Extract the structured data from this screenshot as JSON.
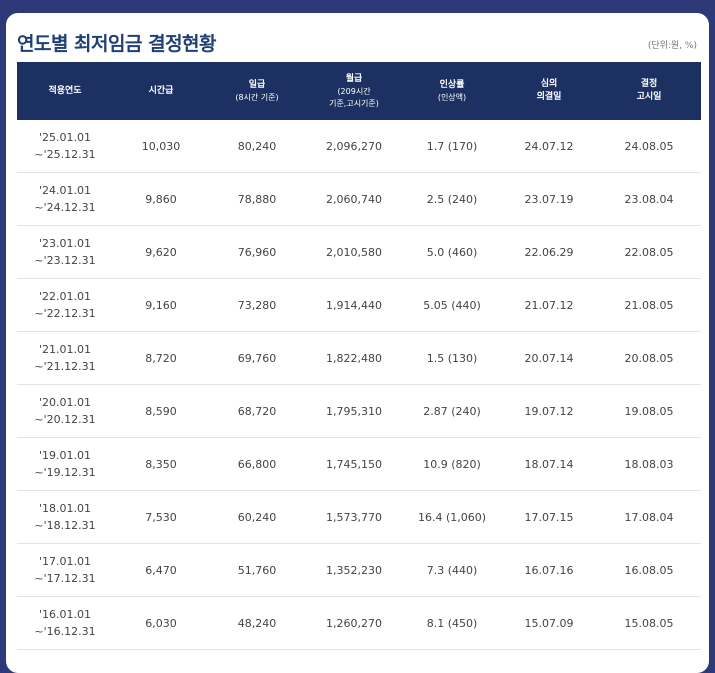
{
  "title": "연도별 최저임금 결정현황",
  "unit": "(단위:원, %)",
  "headers": [
    {
      "main": "적용연도"
    },
    {
      "main": "시간급"
    },
    {
      "main": "일급",
      "sub": "(8시간 기준)"
    },
    {
      "main": "월급",
      "sub1": "(209시간",
      "sub2": "기준,고시기준)"
    },
    {
      "main": "인상률",
      "sub": "(인상액)"
    },
    {
      "line1": "심의",
      "line2": "의결일"
    },
    {
      "line1": "결정",
      "line2": "고시일"
    }
  ],
  "rows": [
    {
      "year_start": "'25.01.01",
      "year_end": "~'25.12.31",
      "hourly": "10,030",
      "daily": "80,240",
      "monthly": "2,096,270",
      "rate": "1.7 (170)",
      "deliberation": "24.07.12",
      "notice": "24.08.05"
    },
    {
      "year_start": "'24.01.01",
      "year_end": "~'24.12.31",
      "hourly": "9,860",
      "daily": "78,880",
      "monthly": "2,060,740",
      "rate": "2.5 (240)",
      "deliberation": "23.07.19",
      "notice": "23.08.04"
    },
    {
      "year_start": "'23.01.01",
      "year_end": "~'23.12.31",
      "hourly": "9,620",
      "daily": "76,960",
      "monthly": "2,010,580",
      "rate": "5.0 (460)",
      "deliberation": "22.06.29",
      "notice": "22.08.05"
    },
    {
      "year_start": "'22.01.01",
      "year_end": "~'22.12.31",
      "hourly": "9,160",
      "daily": "73,280",
      "monthly": "1,914,440",
      "rate": "5.05 (440)",
      "deliberation": "21.07.12",
      "notice": "21.08.05"
    },
    {
      "year_start": "'21.01.01",
      "year_end": "~'21.12.31",
      "hourly": "8,720",
      "daily": "69,760",
      "monthly": "1,822,480",
      "rate": "1.5 (130)",
      "deliberation": "20.07.14",
      "notice": "20.08.05"
    },
    {
      "year_start": "'20.01.01",
      "year_end": "~'20.12.31",
      "hourly": "8,590",
      "daily": "68,720",
      "monthly": "1,795,310",
      "rate": "2.87 (240)",
      "deliberation": "19.07.12",
      "notice": "19.08.05"
    },
    {
      "year_start": "'19.01.01",
      "year_end": "~'19.12.31",
      "hourly": "8,350",
      "daily": "66,800",
      "monthly": "1,745,150",
      "rate": "10.9 (820)",
      "deliberation": "18.07.14",
      "notice": "18.08.03"
    },
    {
      "year_start": "'18.01.01",
      "year_end": "~'18.12.31",
      "hourly": "7,530",
      "daily": "60,240",
      "monthly": "1,573,770",
      "rate": "16.4 (1,060)",
      "deliberation": "17.07.15",
      "notice": "17.08.04"
    },
    {
      "year_start": "'17.01.01",
      "year_end": "~'17.12.31",
      "hourly": "6,470",
      "daily": "51,760",
      "monthly": "1,352,230",
      "rate": "7.3 (440)",
      "deliberation": "16.07.16",
      "notice": "16.08.05"
    },
    {
      "year_start": "'16.01.01",
      "year_end": "~'16.12.31",
      "hourly": "6,030",
      "daily": "48,240",
      "monthly": "1,260,270",
      "rate": "8.1 (450)",
      "deliberation": "15.07.09",
      "notice": "15.08.05"
    }
  ]
}
